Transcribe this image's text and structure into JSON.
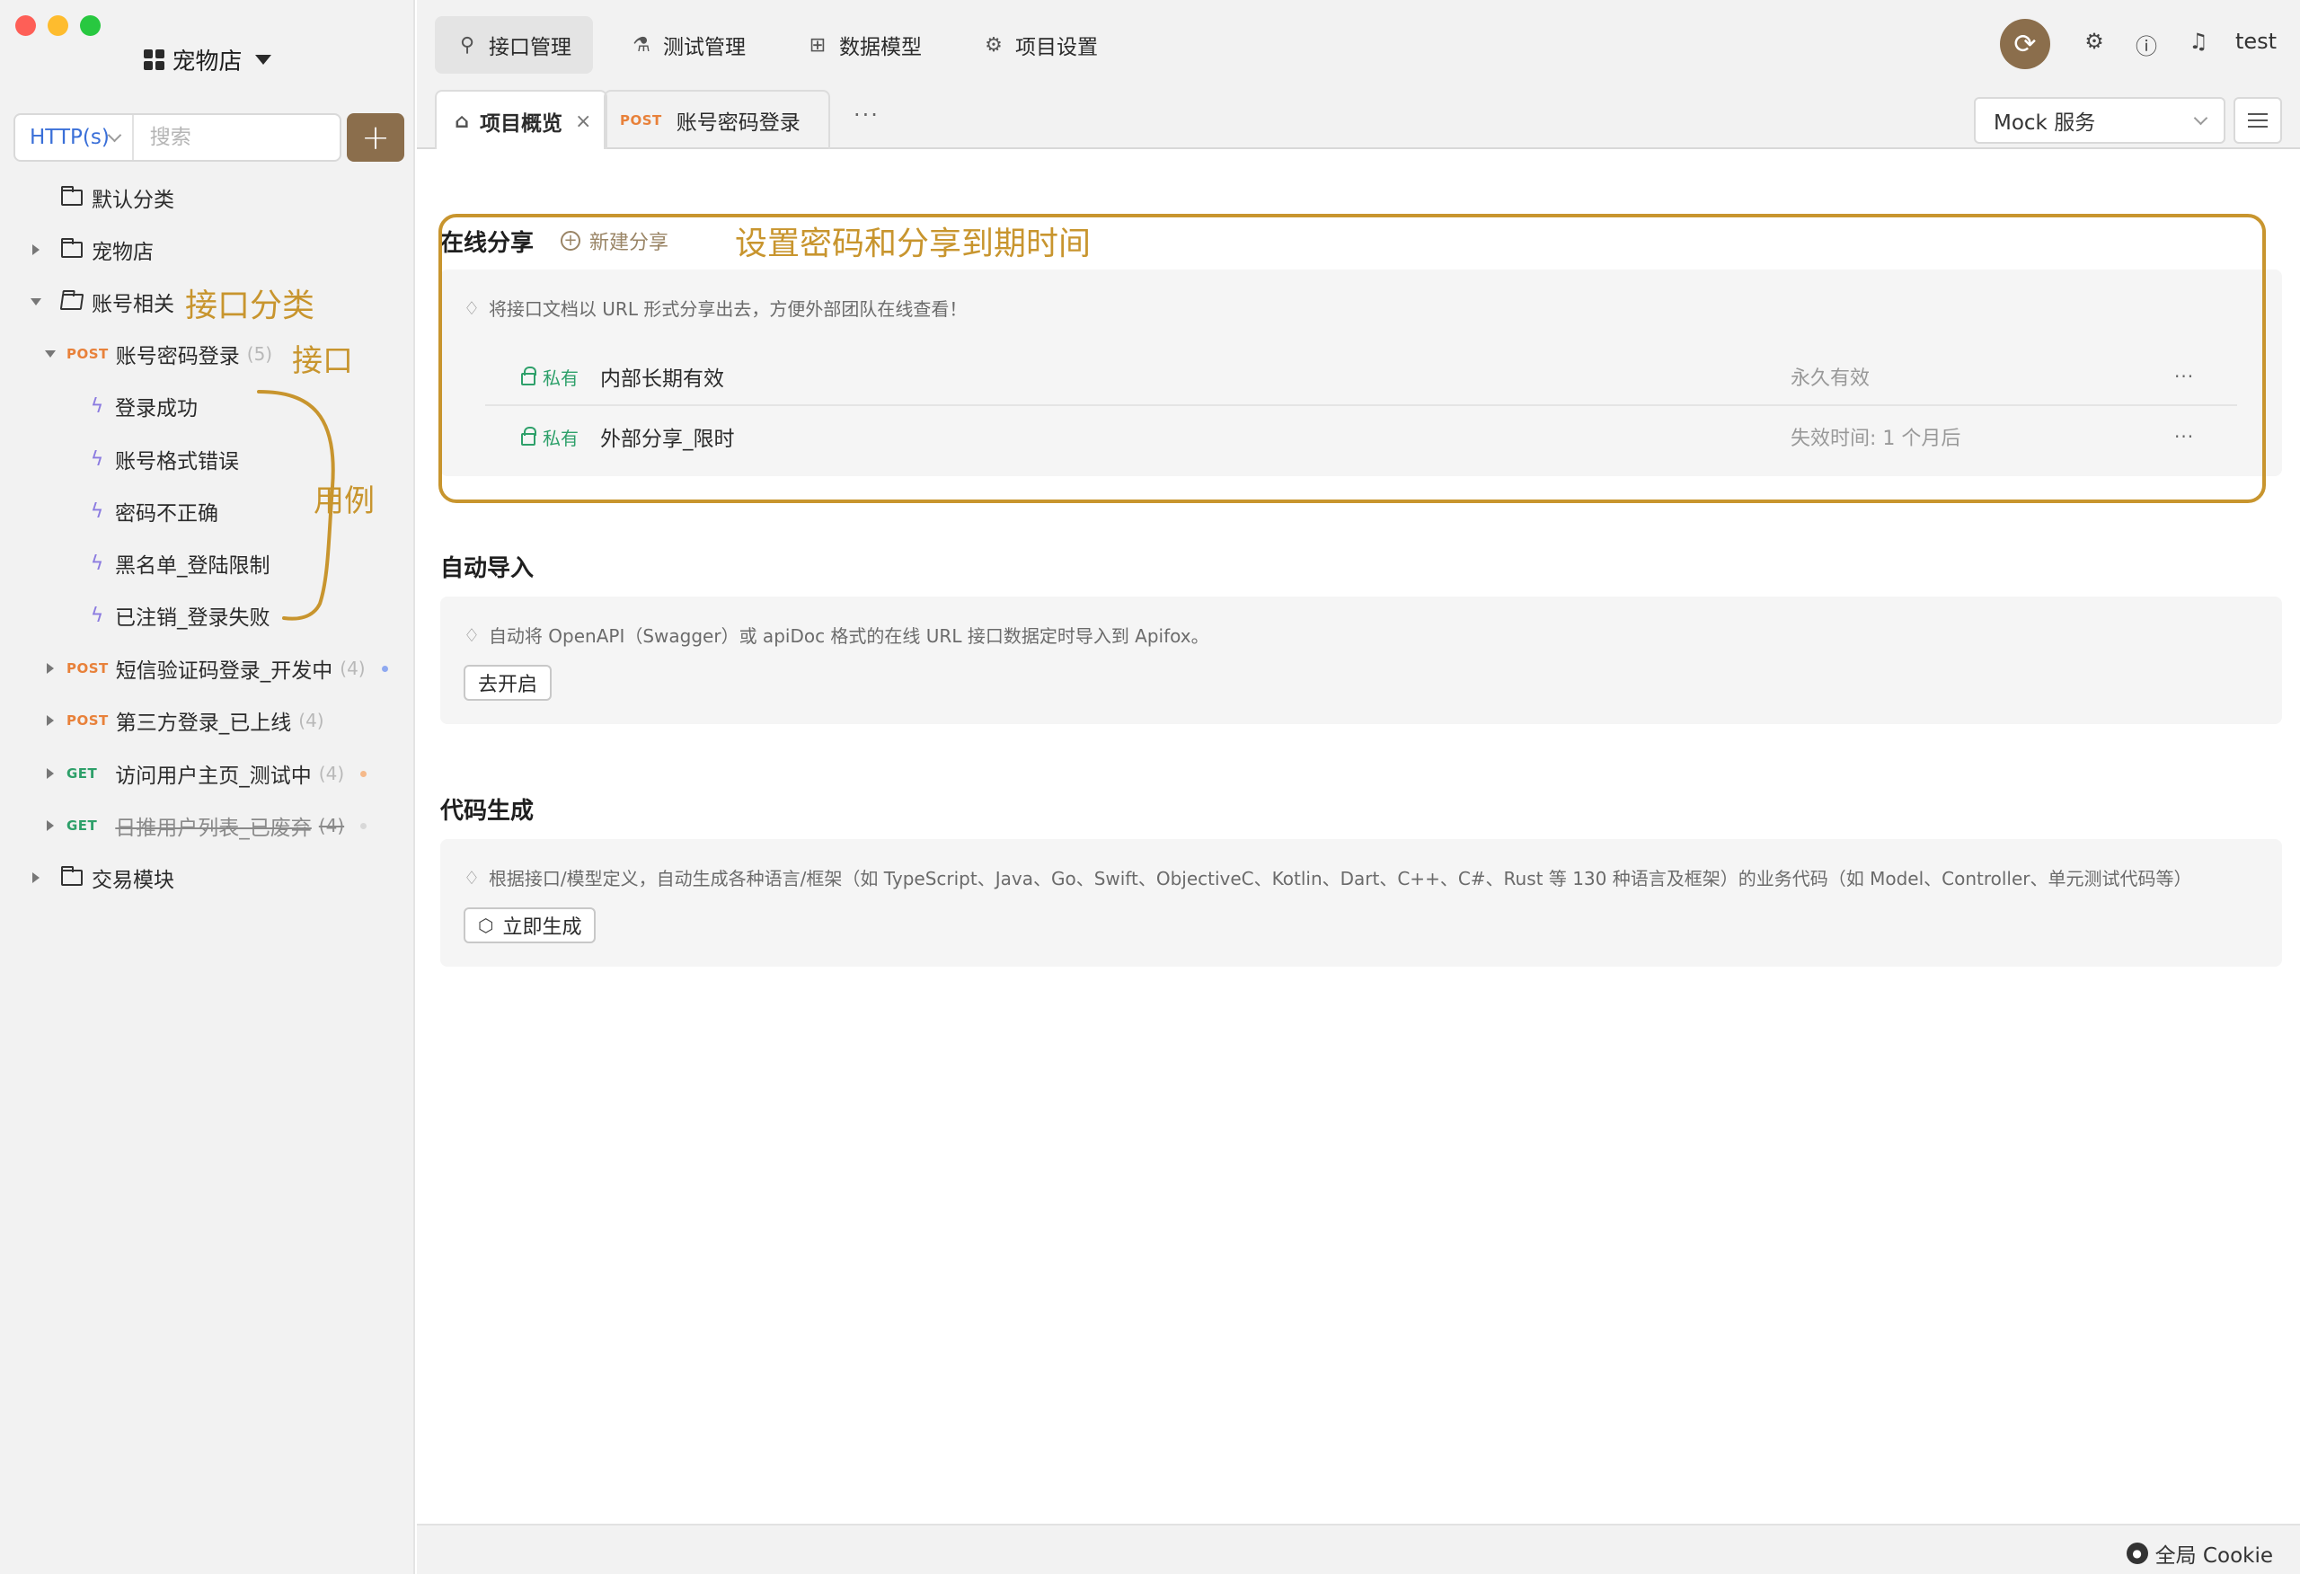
{
  "window": {
    "project_name": "宠物店"
  },
  "sidebar": {
    "protocol": "HTTP(s)",
    "search_placeholder": "搜索",
    "add_label": "+",
    "tree": [
      {
        "type": "folder",
        "label": "默认分类"
      },
      {
        "type": "folder",
        "label": "宠物店"
      },
      {
        "type": "folder",
        "label": "账号相关",
        "expanded": true
      },
      {
        "type": "api",
        "method": "POST",
        "label": "账号密码登录",
        "count": "(5)",
        "expanded": true
      },
      {
        "type": "case",
        "label": "登录成功"
      },
      {
        "type": "case",
        "label": "账号格式错误"
      },
      {
        "type": "case",
        "label": "密码不正确"
      },
      {
        "type": "case",
        "label": "黑名单_登陆限制"
      },
      {
        "type": "case",
        "label": "已注销_登录失败"
      },
      {
        "type": "api",
        "method": "POST",
        "label": "短信验证码登录_开发中",
        "count": "(4)",
        "dot_color": "#8fa9f0"
      },
      {
        "type": "api",
        "method": "POST",
        "label": "第三方登录_已上线",
        "count": "(4)"
      },
      {
        "type": "api",
        "method": "GET",
        "label": "访问用户主页_测试中",
        "count": "(4)",
        "dot_color": "#f5b98a"
      },
      {
        "type": "api",
        "method": "GET",
        "label": "日推用户列表_已废弃",
        "count": "(4)",
        "dot_color": "#d8d8d8",
        "deprecated": true
      },
      {
        "type": "folder",
        "label": "交易模块"
      }
    ],
    "annotations": {
      "category": "接口分类",
      "api": "接口",
      "cases": "用例"
    }
  },
  "topnav": {
    "tabs": [
      {
        "label": "接口管理",
        "icon": "link-icon",
        "active": true
      },
      {
        "label": "测试管理",
        "icon": "flask-icon"
      },
      {
        "label": "数据模型",
        "icon": "model-icon"
      },
      {
        "label": "项目设置",
        "icon": "gear-icon"
      }
    ],
    "user": "test"
  },
  "doctabs": {
    "tabs": [
      {
        "label": "项目概览",
        "icon": "bank-icon",
        "active": true
      },
      {
        "method": "POST",
        "label": "账号密码登录"
      }
    ],
    "more": "···",
    "env_select": "Mock 服务"
  },
  "main": {
    "share": {
      "title": "在线分享",
      "new_label": "新建分享",
      "annotation": "设置密码和分享到期时间",
      "hint": "将接口文档以 URL 形式分享出去，方便外部团队在线查看！",
      "rows": [
        {
          "tag": "私有",
          "name": "内部长期有效",
          "expiry": "永久有效"
        },
        {
          "tag": "私有",
          "name": "外部分享_限时",
          "expiry": "失效时间: 1 个月后"
        }
      ],
      "row_more": "···"
    },
    "import": {
      "title": "自动导入",
      "hint": "自动将 OpenAPI（Swagger）或 apiDoc 格式的在线 URL 接口数据定时导入到 Apifox。",
      "button": "去开启"
    },
    "codegen": {
      "title": "代码生成",
      "hint": "根据接口/模型定义，自动生成各种语言/框架（如 TypeScript、Java、Go、Swift、ObjectiveC、Kotlin、Dart、C++、C#、Rust 等 130 种语言及框架）的业务代码（如 Model、Controller、单元测试代码等）",
      "button": "立即生成"
    }
  },
  "statusbar": {
    "cookie": "全局 Cookie"
  },
  "colors": {
    "accent": "#8b6e4c",
    "annotation": "#c8952e",
    "post": "#e8813a",
    "get": "#2ea06a"
  }
}
